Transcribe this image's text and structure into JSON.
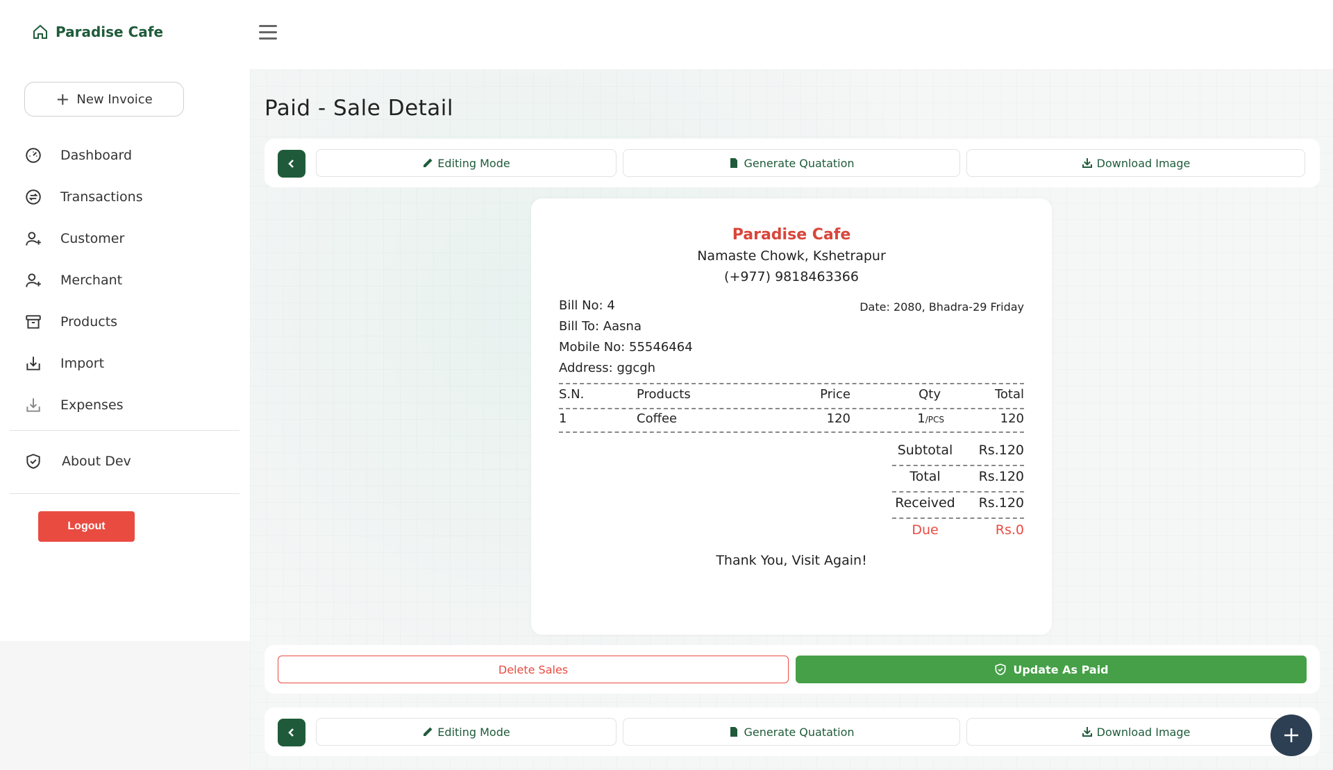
{
  "app": {
    "brand": "Paradise Cafe",
    "accent": "#1f5b3a",
    "danger": "#e94b41",
    "success": "#45a047"
  },
  "sidebar": {
    "new_invoice": "New Invoice",
    "items": [
      {
        "label": "Dashboard",
        "icon": "dashboard-icon"
      },
      {
        "label": "Transactions",
        "icon": "transactions-icon"
      },
      {
        "label": "Customer",
        "icon": "user-plus-icon"
      },
      {
        "label": "Merchant",
        "icon": "user-plus-icon"
      },
      {
        "label": "Products",
        "icon": "archive-icon"
      },
      {
        "label": "Import",
        "icon": "import-icon"
      },
      {
        "label": "Expenses",
        "icon": "download-icon"
      }
    ],
    "about": "About Dev",
    "logout": "Logout"
  },
  "page": {
    "title": "Paid - Sale Detail"
  },
  "toolbar": {
    "editing": "Editing Mode",
    "quotation": "Generate Quatation",
    "download": "Download Image"
  },
  "receipt": {
    "name": "Paradise Cafe",
    "address": "Namaste Chowk, Kshetrapur",
    "phone": "(+977) 9818463366",
    "bill_no": "Bill No: 4",
    "date": "Date: 2080, Bhadra-29 Friday",
    "bill_to": "Bill To: Aasna",
    "mobile": "Mobile No: 55546464",
    "address_line": "Address: ggcgh",
    "headers": {
      "sn": "S.N.",
      "product": "Products",
      "price": "Price",
      "qty": "Qty",
      "total": "Total"
    },
    "rows": [
      {
        "sn": "1",
        "product": "Coffee",
        "price": "120",
        "qty": "1",
        "unit": "/PCS",
        "total": "120"
      }
    ],
    "summary": {
      "subtotal_label": "Subtotal",
      "subtotal": "Rs.120",
      "total_label": "Total",
      "total": "Rs.120",
      "received_label": "Received",
      "received": "Rs.120",
      "due_label": "Due",
      "due": "Rs.0"
    },
    "thanks": "Thank You, Visit Again!"
  },
  "actions": {
    "delete": "Delete Sales",
    "paid": "Update As Paid"
  }
}
